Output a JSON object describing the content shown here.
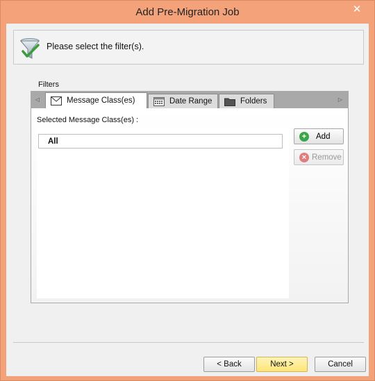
{
  "window": {
    "title": "Add Pre-Migration Job",
    "close_glyph": "✕"
  },
  "header": {
    "icon": "filter-funnel-check-icon",
    "text": "Please select the filter(s)."
  },
  "filters": {
    "label": "Filters",
    "scroll_left_glyph": "◁",
    "scroll_right_glyph": "▷",
    "tabs": [
      {
        "label": "Message Class(es)",
        "icon": "envelope-icon",
        "active": true
      },
      {
        "label": "Date Range",
        "icon": "calendar-icon",
        "active": false
      },
      {
        "label": "Folders",
        "icon": "folder-icon",
        "active": false
      }
    ],
    "selected_label": "Selected Message Class(es) :",
    "items": [
      "All"
    ],
    "add_label": "Add",
    "remove_label": "Remove"
  },
  "footer": {
    "back_label": "< Back",
    "next_label": "Next >",
    "cancel_label": "Cancel"
  },
  "colors": {
    "frame": "#f4a27a",
    "next_button": "#fde577",
    "add_icon": "#3aa64a",
    "remove_icon": "#e07d7d"
  }
}
